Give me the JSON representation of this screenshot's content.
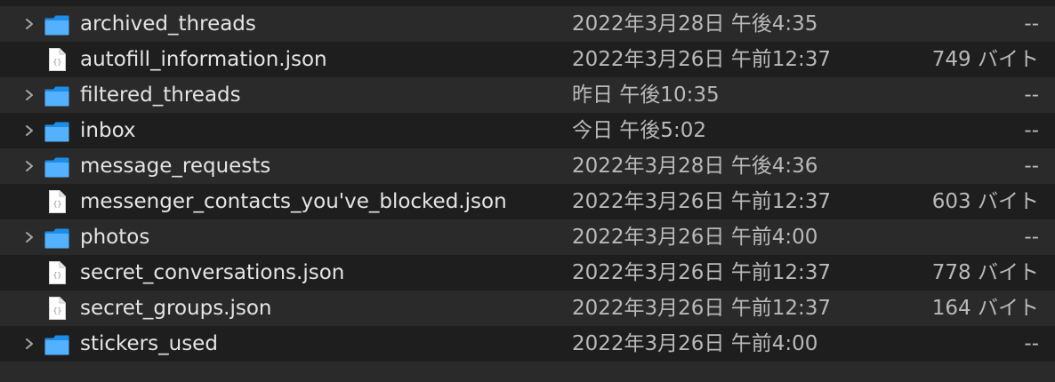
{
  "colors": {
    "background_even": "#1e1e1e",
    "background_odd": "#2a2a2a",
    "text_primary": "#e4e4e4",
    "text_secondary": "#b9b9b9",
    "folder_blue": "#47a9f3"
  },
  "rows": [
    {
      "name": "archived_threads",
      "date": "2022年3月28日 午後4:35",
      "size": "--",
      "kind": "folder",
      "icon": "folder-icon"
    },
    {
      "name": "autofill_information.json",
      "date": "2022年3月26日 午前12:37",
      "size": "749 バイト",
      "kind": "file",
      "icon": "json-file-icon"
    },
    {
      "name": "filtered_threads",
      "date": "昨日 午後10:35",
      "size": "--",
      "kind": "folder",
      "icon": "folder-icon"
    },
    {
      "name": "inbox",
      "date": "今日 午後5:02",
      "size": "--",
      "kind": "folder",
      "icon": "folder-icon"
    },
    {
      "name": "message_requests",
      "date": "2022年3月28日 午後4:36",
      "size": "--",
      "kind": "folder",
      "icon": "folder-icon"
    },
    {
      "name": "messenger_contacts_you've_blocked.json",
      "date": "2022年3月26日 午前12:37",
      "size": "603 バイト",
      "kind": "file",
      "icon": "json-file-icon"
    },
    {
      "name": "photos",
      "date": "2022年3月26日 午前4:00",
      "size": "--",
      "kind": "folder",
      "icon": "folder-icon"
    },
    {
      "name": "secret_conversations.json",
      "date": "2022年3月26日 午前12:37",
      "size": "778 バイト",
      "kind": "file",
      "icon": "json-file-icon"
    },
    {
      "name": "secret_groups.json",
      "date": "2022年3月26日 午前12:37",
      "size": "164 バイト",
      "kind": "file",
      "icon": "json-file-icon"
    },
    {
      "name": "stickers_used",
      "date": "2022年3月26日 午前4:00",
      "size": "--",
      "kind": "folder",
      "icon": "folder-icon"
    }
  ]
}
